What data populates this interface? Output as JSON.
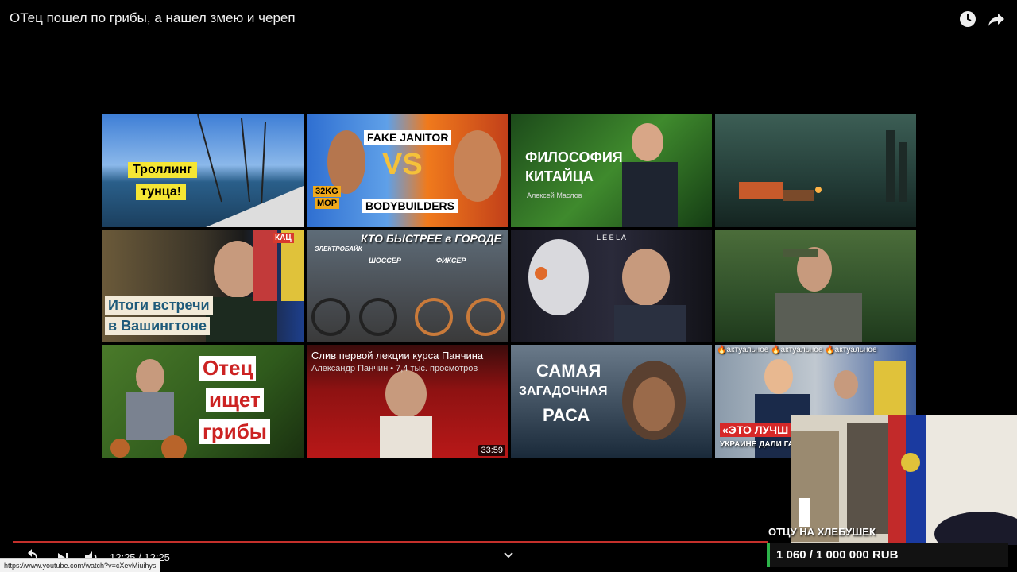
{
  "video": {
    "title": "ОТец пошел по грибы, а нашел змею и череп"
  },
  "icons": {
    "watch_later": "clock-icon",
    "share": "share-icon",
    "replay": "replay-icon",
    "next": "next-icon",
    "volume": "volume-icon",
    "chevron": "chevron-down-icon",
    "subtitles": "subtitles-icon",
    "settings": "settings-icon",
    "fullscreen": "exit-fullscreen-icon"
  },
  "endscreen": [
    {
      "caption_lines": [
        "Троллинг",
        "тунца!"
      ]
    },
    {
      "caption_lines": [
        "FAKE JANITOR",
        "VS",
        "BODYBUILDERS",
        "32KG",
        "MOP"
      ]
    },
    {
      "caption_lines": [
        "ФИЛОСОФИЯ",
        "КИТАЙЦА",
        "Алексей Маслов"
      ]
    },
    {
      "caption_lines": []
    },
    {
      "caption_lines": [
        "Итоги встречи",
        "в Вашингтоне",
        "КАЦ"
      ]
    },
    {
      "caption_lines": [
        "КТО БЫСТРЕЕ в ГОРОДЕ",
        "ЭЛЕКТРОБАЙК",
        "ШОССЕР",
        "ФИКСЕР"
      ]
    },
    {
      "caption_lines": [
        "L E E L A"
      ]
    },
    {
      "caption_lines": []
    },
    {
      "caption_lines": [
        "Отец",
        "ищет",
        "грибы"
      ]
    },
    {
      "hover_title": "Слив первой лекции курса Панчина",
      "hover_meta": "Александр Панчин • 7,4 тыс. просмотров",
      "duration": "33:59"
    },
    {
      "caption_lines": [
        "САМАЯ",
        "ЗАГАДОЧНАЯ",
        "РАСА"
      ]
    },
    {
      "caption_lines": [
        "🔥актуальное 🔥актуальное 🔥актуальное",
        "«ЭТО ЛУЧШ",
        "УКРАИНЕ ДАЛИ ГА"
      ]
    }
  ],
  "player": {
    "time": "12:25 / 12:25",
    "progress_fraction": 1.0
  },
  "status_url": "https://www.youtube.com/watch?v=cXevMiuihys",
  "overlay": {
    "goal_title": "ОТЦУ НА ХЛЕБУШЕК",
    "goal_amount": "1 060 / 1 000 000 RUB"
  }
}
